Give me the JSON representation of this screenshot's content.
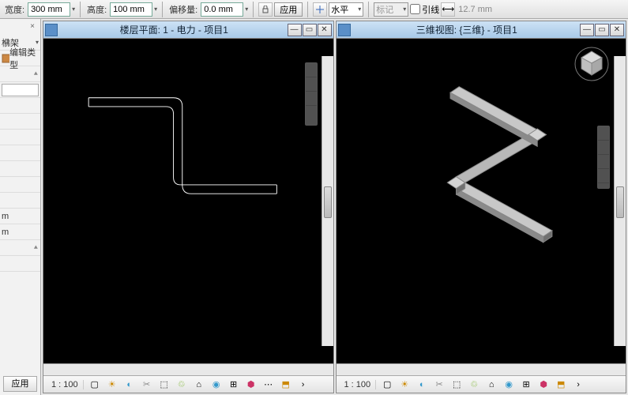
{
  "toolbar": {
    "width_label": "宽度:",
    "width_value": "300 mm",
    "height_label": "高度:",
    "height_value": "100 mm",
    "offset_label": "偏移量:",
    "offset_value": "0.0 mm",
    "apply_label": "应用",
    "align_label": "水平",
    "mark_label": "标记",
    "leader_label": "引线",
    "leader_value": "12.7 mm"
  },
  "left_panel": {
    "close": "×",
    "prop1": "梻架",
    "edit_type_label": "编辑类型",
    "rows": [
      "",
      "",
      "",
      "",
      "",
      "",
      "",
      "",
      "m",
      "m",
      "",
      ""
    ],
    "bottom": "应用"
  },
  "views": {
    "left": {
      "title": "楼层平面: 1 - 电力 - 项目1",
      "scale": "1 : 100"
    },
    "right": {
      "title": "三维视图: {三维} - 项目1",
      "scale": "1 : 100"
    }
  },
  "colors": {
    "canvas_bg": "#000000",
    "line2d": "#ffffff",
    "line3d": "#b8b8b8"
  }
}
